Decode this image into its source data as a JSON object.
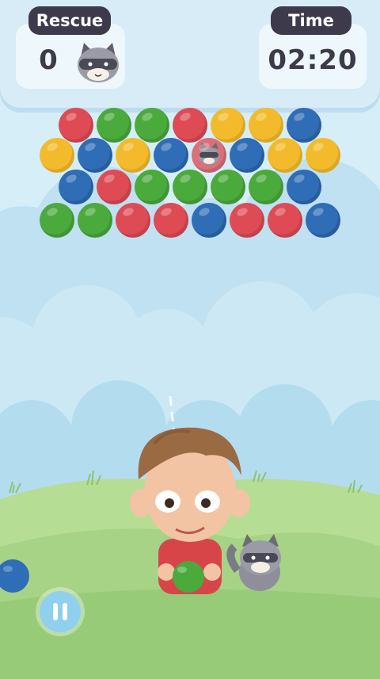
{
  "hud": {
    "rescue_label": "Rescue",
    "rescue_count": "0",
    "time_label": "Time",
    "time_value": "02:20"
  },
  "bubble_grid": {
    "rows": [
      [
        "red",
        "green",
        "green",
        "red",
        "yellow",
        "yellow",
        "blue"
      ],
      [
        "yellow",
        "blue",
        "yellow",
        "blue",
        "trapped-raccoon",
        "blue",
        "yellow",
        "yellow"
      ],
      [
        "blue",
        "red",
        "green",
        "green",
        "green",
        "green",
        "blue"
      ],
      [
        "green",
        "green",
        "red",
        "red",
        "blue",
        "red",
        "red",
        "blue"
      ]
    ]
  },
  "shooter": {
    "loaded_bubble": "green",
    "next_bubble": "blue"
  },
  "icons": {
    "rescue": "raccoon-icon",
    "pause": "pause-icon"
  },
  "colors": {
    "red": "#de4b55",
    "green": "#4aaa3c",
    "yellow": "#f3bb2c",
    "blue": "#2f6db6",
    "hud_dark": "#3d3a4b",
    "sky": "#cfe9f6",
    "grass": "#9dcf78"
  }
}
